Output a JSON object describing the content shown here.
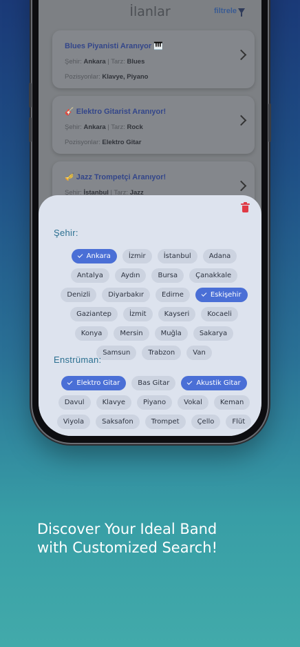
{
  "listings": {
    "title": "İlanlar",
    "filter_label": "filtrele",
    "cards": [
      {
        "title": "Blues Piyanisti Aranıyor 🎹",
        "city_label": "Şehir:",
        "city": "Ankara",
        "genre_label": "Tarz:",
        "genre": "Blues",
        "positions_label": "Pozisyonlar:",
        "positions": "Klavye, Piyano"
      },
      {
        "title": "🎸 Elektro Gitarist Aranıyor!",
        "city_label": "Şehir:",
        "city": "Ankara",
        "genre_label": "Tarz:",
        "genre": "Rock",
        "positions_label": "Pozisyonlar:",
        "positions": "Elektro Gitar"
      },
      {
        "title": "🎺 Jazz Trompetçi Aranıyor!",
        "city_label": "Şehir:",
        "city": "İstanbul",
        "genre_label": "Tarz:",
        "genre": "Jazz"
      }
    ]
  },
  "filter_sheet": {
    "city_title": "Şehir:",
    "cities": [
      {
        "label": "Ankara",
        "selected": true
      },
      {
        "label": "İzmir",
        "selected": false
      },
      {
        "label": "İstanbul",
        "selected": false
      },
      {
        "label": "Adana",
        "selected": false
      },
      {
        "label": "Antalya",
        "selected": false
      },
      {
        "label": "Aydın",
        "selected": false
      },
      {
        "label": "Bursa",
        "selected": false
      },
      {
        "label": "Çanakkale",
        "selected": false
      },
      {
        "label": "Denizli",
        "selected": false
      },
      {
        "label": "Diyarbakır",
        "selected": false
      },
      {
        "label": "Edirne",
        "selected": false
      },
      {
        "label": "Eskişehir",
        "selected": true
      },
      {
        "label": "Gaziantep",
        "selected": false
      },
      {
        "label": "İzmit",
        "selected": false
      },
      {
        "label": "Kayseri",
        "selected": false
      },
      {
        "label": "Kocaeli",
        "selected": false
      },
      {
        "label": "Konya",
        "selected": false
      },
      {
        "label": "Mersin",
        "selected": false
      },
      {
        "label": "Muğla",
        "selected": false
      },
      {
        "label": "Sakarya",
        "selected": false
      },
      {
        "label": "Samsun",
        "selected": false
      },
      {
        "label": "Trabzon",
        "selected": false
      },
      {
        "label": "Van",
        "selected": false
      }
    ],
    "instrument_title": "Enstrüman:",
    "instruments": [
      {
        "label": "Elektro Gitar",
        "selected": true
      },
      {
        "label": "Bas Gitar",
        "selected": false
      },
      {
        "label": "Akustik Gitar",
        "selected": true
      },
      {
        "label": "Davul",
        "selected": false
      },
      {
        "label": "Klavye",
        "selected": false
      },
      {
        "label": "Piyano",
        "selected": false
      },
      {
        "label": "Vokal",
        "selected": false
      },
      {
        "label": "Keman",
        "selected": false
      },
      {
        "label": "Viyola",
        "selected": false
      },
      {
        "label": "Saksafon",
        "selected": false
      },
      {
        "label": "Trompet",
        "selected": false
      },
      {
        "label": "Çello",
        "selected": false
      },
      {
        "label": "Flüt",
        "selected": false
      }
    ]
  },
  "headline": {
    "line1": "Discover Your Ideal Band",
    "line2": "with Customized Search!"
  },
  "colors": {
    "accent": "#4a6fd6",
    "delete": "#e03a45",
    "section_title": "#2a6f90"
  }
}
